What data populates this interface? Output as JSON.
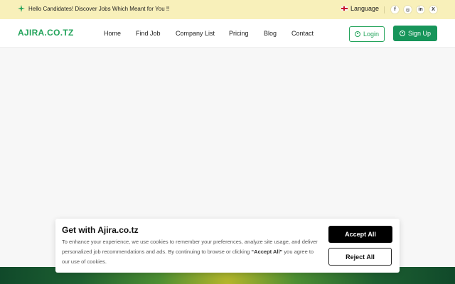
{
  "topbar": {
    "promo_text": "Hello Candidates! Discover Jobs Which Meant for You !!",
    "promo_icon": "sparkle-icon",
    "language_label": "Language",
    "language_icon": "uk-flag-icon",
    "social": [
      {
        "name": "facebook",
        "glyph": "f"
      },
      {
        "name": "instagram",
        "glyph": "◎"
      },
      {
        "name": "linkedin",
        "glyph": "in"
      },
      {
        "name": "x",
        "glyph": "X"
      }
    ]
  },
  "navbar": {
    "logo": "AJIRA.CO.TZ",
    "links": [
      "Home",
      "Find Job",
      "Company List",
      "Pricing",
      "Blog",
      "Contact"
    ],
    "login_label": "Login",
    "signup_label": "Sign Up"
  },
  "cookie": {
    "title": "Get with Ajira.co.tz",
    "text_part1": "To enhance your experience, we use cookies to remember your preferences, analyze site usage, and deliver personalized job recommendations and ads. By continuing to browse or clicking ",
    "text_emphasis": "“Accept All”",
    "text_part2": " you agree to our use of cookies.",
    "accept_label": "Accept All",
    "reject_label": "Reject All"
  },
  "colors": {
    "brand_green": "#22a35a",
    "signup_green": "#17955a",
    "topbar_yellow": "#f8f0ba"
  }
}
